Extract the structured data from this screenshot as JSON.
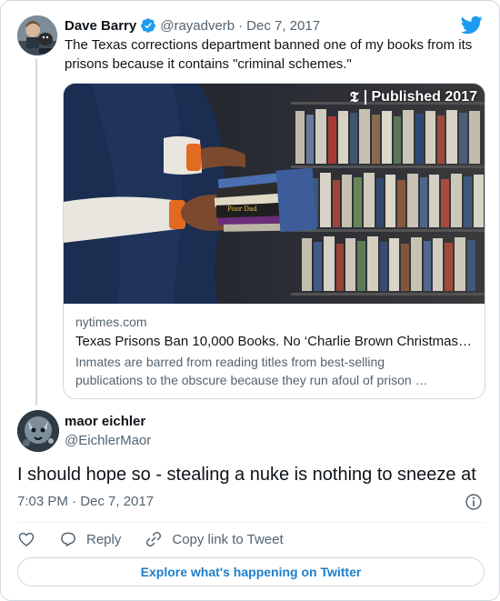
{
  "parent_tweet": {
    "display_name": "Dave Barry",
    "handle": "@rayadverb",
    "separator": "·",
    "date": "Dec 7, 2017",
    "text": "The Texas corrections department banned one of my books from its prisons because it contains \"criminal schemes.\"",
    "link_card": {
      "badge": "Published 2017",
      "domain": "nytimes.com",
      "title": "Texas Prisons Ban 10,000 Books. No ‘Charlie Brown Christmas…",
      "description_line1": "Inmates are barred from reading titles from best-selling",
      "description_line2": "publications to the obscure because they run afoul of prison …"
    }
  },
  "reply_tweet": {
    "display_name": "maor eichler",
    "handle": "@EichlerMaor",
    "text": "I should hope so - stealing a nuke is nothing to sneeze at",
    "timestamp": "7:03 PM · Dec 7, 2017"
  },
  "actions": {
    "reply_label": "Reply",
    "copy_link_label": "Copy link to Tweet"
  },
  "explore_label": "Explore what's happening on Twitter",
  "colors": {
    "accent": "#1d9bf0",
    "explore_text": "#1d7fc9",
    "secondary_text": "#536471",
    "border": "#cfd9de"
  },
  "icons": [
    "verified-badge-icon",
    "twitter-bird-icon",
    "info-icon",
    "heart-icon",
    "reply-icon",
    "link-icon"
  ]
}
